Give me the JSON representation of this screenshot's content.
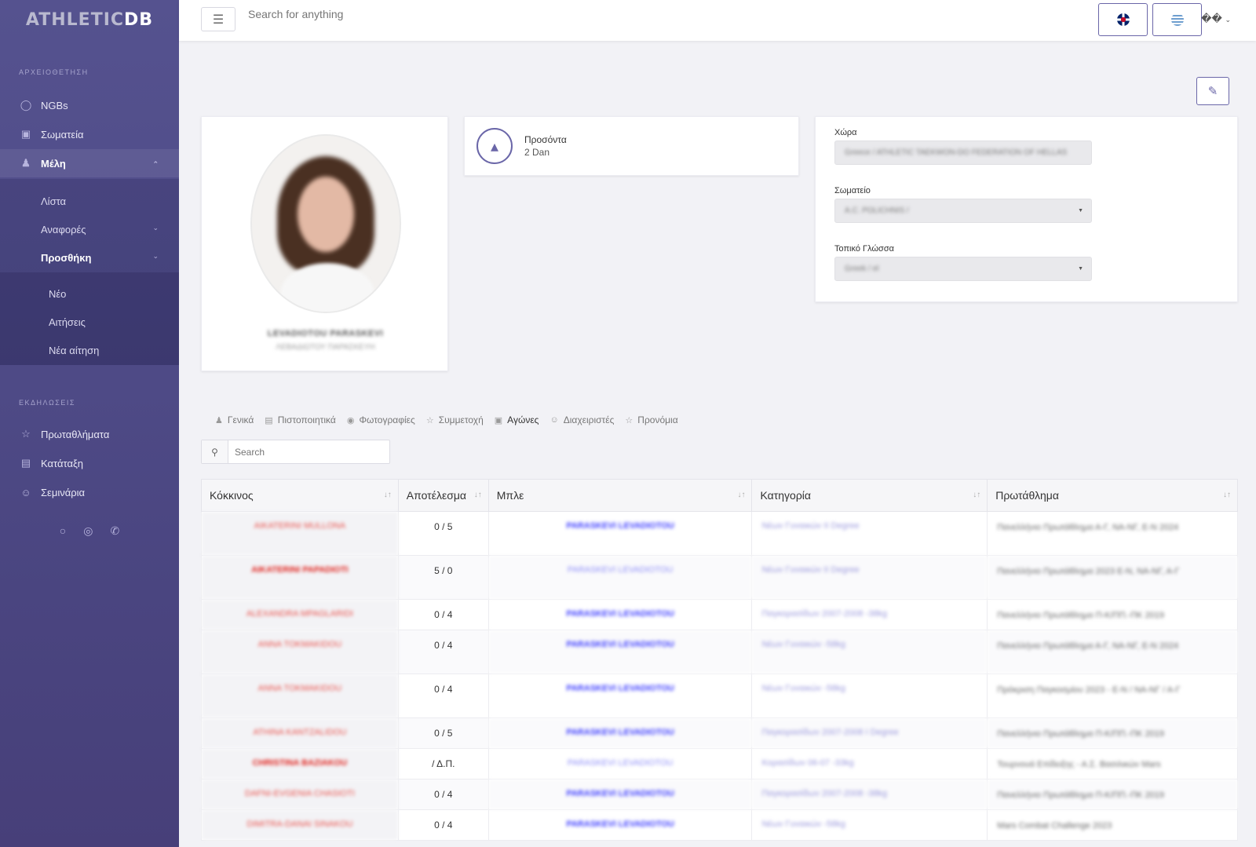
{
  "logo": {
    "part1": "ATHLETIC",
    "part2": "DB"
  },
  "sidebar": {
    "section1": "ΑΡΧΕΙΟΘΕΤΗΣΗ",
    "items": [
      {
        "label": "NGBs",
        "icon": "lightbulb-icon"
      },
      {
        "label": "Σωματεία",
        "icon": "wallet-icon"
      },
      {
        "label": "Μέλη",
        "icon": "member-icon"
      }
    ],
    "members_sub": [
      {
        "label": "Λίστα"
      },
      {
        "label": "Αναφορές"
      },
      {
        "label": "Προσθήκη"
      }
    ],
    "add_sub": [
      {
        "label": "Νέο"
      },
      {
        "label": "Αιτήσεις"
      },
      {
        "label": "Νέα αίτηση"
      }
    ],
    "section2": "ΕΚΔΗΛΩΣΕΙΣ",
    "events": [
      {
        "label": "Πρωταθλήματα",
        "icon": "trophy-icon"
      },
      {
        "label": "Κατάταξη",
        "icon": "bar-chart-icon"
      },
      {
        "label": "Σεμινάρια",
        "icon": "user-group-icon"
      }
    ]
  },
  "topbar": {
    "search_placeholder": "Search for anything",
    "user_label": "��"
  },
  "profile": {
    "name": "LEVADIOTOU PARASKEVI",
    "name_local": "ΛΕΒΑΔΙΩΤΟΥ ΠΑΡΑΣΚΕΥΗ"
  },
  "qualifications": {
    "title": "Προσόντα",
    "value": "2 Dan"
  },
  "fields": {
    "country_label": "Χώρα",
    "country_value": "Greece / ATHLETIC TAEKWON-DO FEDERATION OF HELLAS",
    "club_label": "Σωματείο",
    "club_value": "A.C. POLICHNIS /",
    "language_label": "Τοπικό Γλώσσα",
    "language_value": "Greek / el"
  },
  "tabs": [
    {
      "label": "Γενικά",
      "icon": "person-icon"
    },
    {
      "label": "Πιστοποιητικά",
      "icon": "id-card-icon"
    },
    {
      "label": "Φωτογραφίες",
      "icon": "camera-icon"
    },
    {
      "label": "Συμμετοχή",
      "icon": "trophy-icon"
    },
    {
      "label": "Αγώνες",
      "icon": "wallet-icon"
    },
    {
      "label": "Διαχειριστές",
      "icon": "user-icon"
    },
    {
      "label": "Προνόμια",
      "icon": "star-icon"
    }
  ],
  "table_search_placeholder": "Search",
  "table": {
    "headers": [
      "Κόκκινος",
      "Αποτέλεσμα",
      "Μπλε",
      "Κατηγορία",
      "Πρωτάθλημα"
    ],
    "rows": [
      {
        "red": "AIKATERINI MULLONA",
        "result": "0 / 5",
        "blue": "PARASKEVI LEVADIOTOU",
        "category": "Νέων Γυναικών II Degree",
        "championship": "Πανελλήνιο Πρωτάθλημα Α-Γ, ΝΑ-ΝΓ, Ε-Ν 2024"
      },
      {
        "red": "AIKATERINI PAPADIOTI",
        "result": "5 / 0",
        "blue": "PARASKEVI LEVADIOTOU",
        "category": "Νέων Γυναικών II Degree",
        "championship": "Πανελλήνιο Πρωτάθλημα 2023 Ε-Ν, ΝΑ-ΝΓ, Α-Γ"
      },
      {
        "red": "ALEXANDRA MPAGLARIDI",
        "result": "0 / 4",
        "blue": "PARASKEVI LEVADIOTOU",
        "category": "Παγκορασίδων 2007-2008 -38kg",
        "championship": "Πανελλήνιο Πρωτάθλημα Π-Κ/ΠΠ.-ΠΚ 2019"
      },
      {
        "red": "ANNA TOKMAKIDOU",
        "result": "0 / 4",
        "blue": "PARASKEVI LEVADIOTOU",
        "category": "Νέων Γυναικών -58kg",
        "championship": "Πανελλήνιο Πρωτάθλημα Α-Γ, ΝΑ-ΝΓ, Ε-Ν 2024"
      },
      {
        "red": "ANNA TOKMAKIDOU",
        "result": "0 / 4",
        "blue": "PARASKEVI LEVADIOTOU",
        "category": "Νέων Γυναικών -58kg",
        "championship": "Πρόκριση Παγκοσμίου 2023 - Ε-Ν / ΝΑ-ΝΓ / Α-Γ"
      },
      {
        "red": "ATHINA KANTZALIDOU",
        "result": "0 / 5",
        "blue": "PARASKEVI LEVADIOTOU",
        "category": "Παγκορασίδων 2007-2008 I Degree",
        "championship": "Πανελλήνιο Πρωτάθλημα Π-Κ/ΠΠ.-ΠΚ 2019"
      },
      {
        "red": "CHRISTINA BAZIAKOU",
        "result": "/ Δ.Π.",
        "blue": "PARASKEVI LEVADIOTOU",
        "category": "Κορασίδων 06-07 -33kg",
        "championship": "Τουρνουά Επίδειξης - Α.Σ. Βασιλικών Mars"
      },
      {
        "red": "DAFNI-EVGENIA CHASIOTI",
        "result": "0 / 4",
        "blue": "PARASKEVI LEVADIOTOU",
        "category": "Παγκορασίδων 2007-2008 -38kg",
        "championship": "Πανελλήνιο Πρωτάθλημα Π-Κ/ΠΠ.-ΠΚ 2019"
      },
      {
        "red": "DIMITRA-DANAI SINAKOU",
        "result": "0 / 4",
        "blue": "PARASKEVI LEVADIOTOU",
        "category": "Νέων Γυναικών -58kg",
        "championship": "Mars Combat Challenge 2023"
      }
    ]
  }
}
